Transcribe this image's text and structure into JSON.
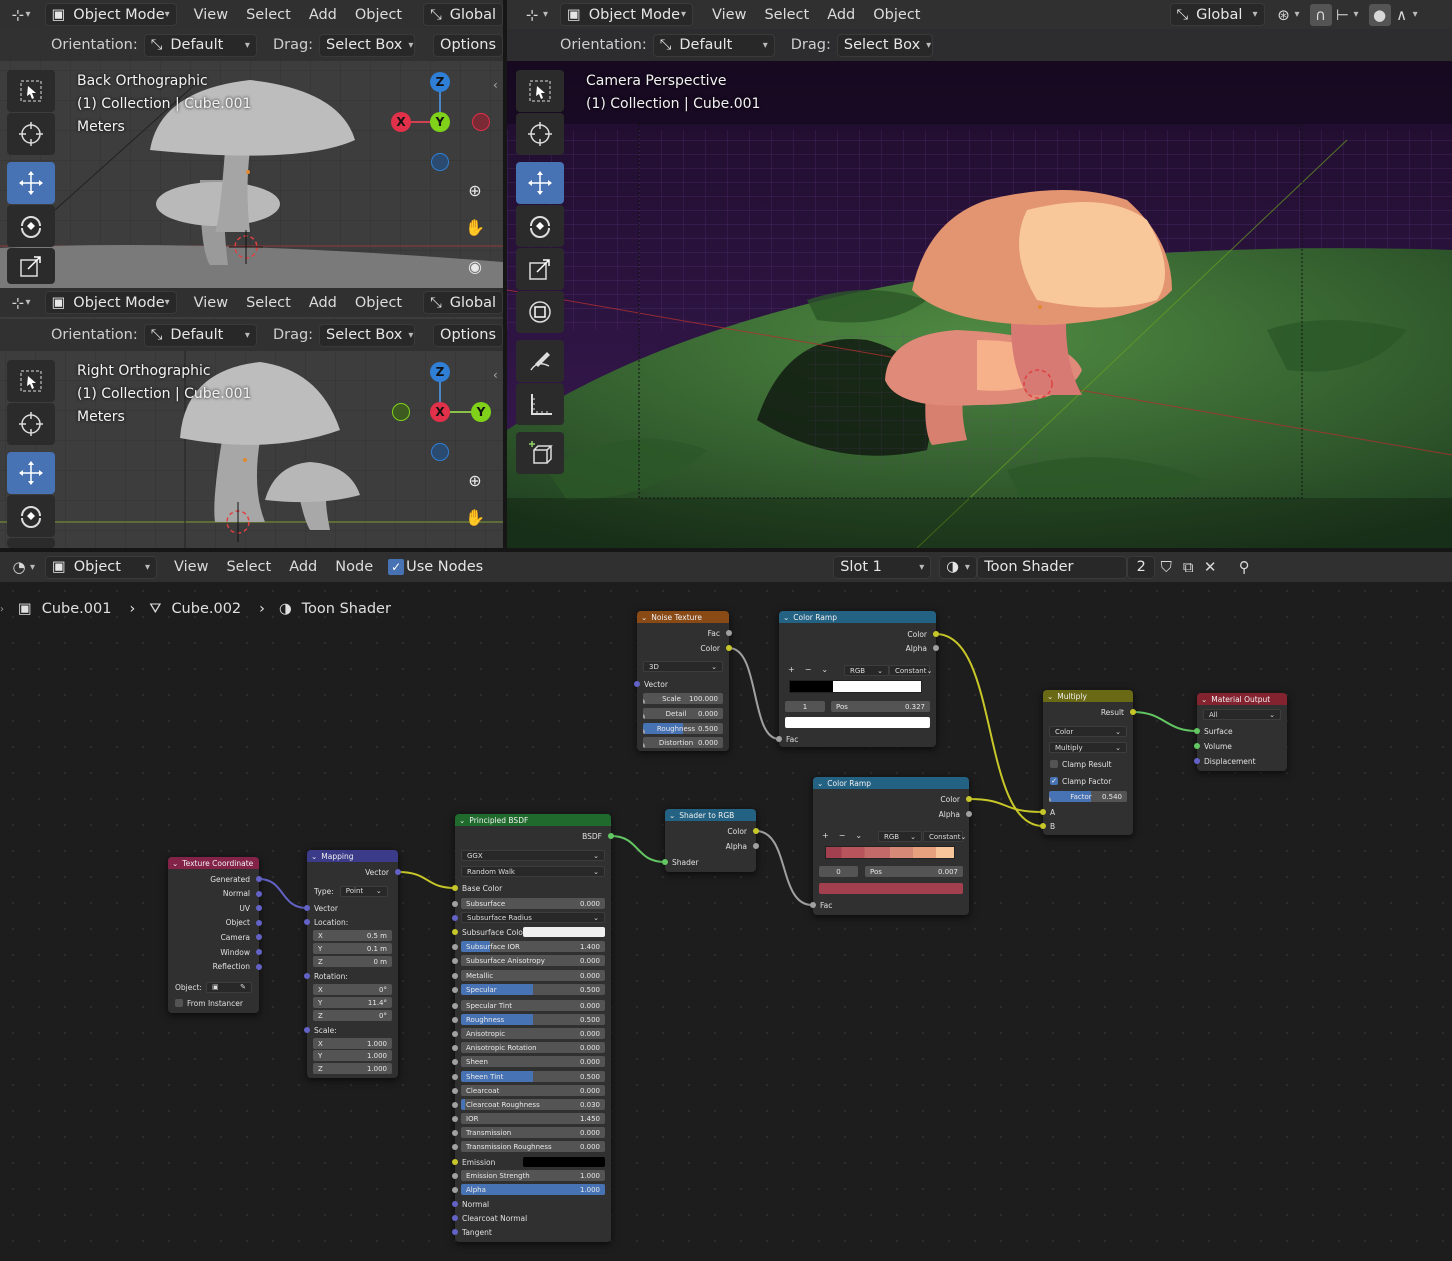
{
  "menus": {
    "object_mode": "Object Mode",
    "view": "View",
    "select": "Select",
    "add": "Add",
    "object": "Object",
    "node": "Node",
    "global": "Global"
  },
  "tool_settings": {
    "orientation_label": "Orientation:",
    "orientation_value": "Default",
    "drag_label": "Drag:",
    "drag_value": "Select Box",
    "options": "Options"
  },
  "viewports": {
    "back": {
      "line1": "Back Orthographic",
      "line2": "(1) Collection | Cube.001",
      "line3": "Meters"
    },
    "right": {
      "line1": "Right Orthographic",
      "line2": "(1) Collection | Cube.001",
      "line3": "Meters"
    },
    "camera": {
      "line1": "Camera Perspective",
      "line2": "(1) Collection | Cube.001"
    }
  },
  "gizmo": {
    "x": "X",
    "y": "Y",
    "z": "Z"
  },
  "node_editor": {
    "header": {
      "object": "Object",
      "use_nodes": "Use Nodes",
      "slot": "Slot 1",
      "material": "Toon Shader",
      "users": "2"
    },
    "breadcrumb": [
      "Cube.001",
      "Cube.002",
      "Toon Shader"
    ],
    "nodes": {
      "noise": {
        "title": "Noise Texture",
        "fac": "Fac",
        "color": "Color",
        "dim": "3D",
        "vector": "Vector",
        "scale_l": "Scale",
        "scale_v": "100.000",
        "detail_l": "Detail",
        "detail_v": "0.000",
        "rough_l": "Roughness",
        "rough_v": "0.500",
        "dist_l": "Distortion",
        "dist_v": "0.000"
      },
      "ramp1": {
        "title": "Color Ramp",
        "color": "Color",
        "alpha": "Alpha",
        "mode": "RGB",
        "interp": "Constant",
        "plus": "+",
        "minus": "−",
        "idx": "1",
        "pos_l": "Pos",
        "pos_v": "0.327",
        "fac": "Fac"
      },
      "ramp2": {
        "title": "Color Ramp",
        "color": "Color",
        "alpha": "Alpha",
        "mode": "RGB",
        "interp": "Constant",
        "plus": "+",
        "minus": "−",
        "idx": "0",
        "pos_l": "Pos",
        "pos_v": "0.007",
        "fac": "Fac"
      },
      "multiply": {
        "title": "Multiply",
        "result": "Result",
        "type": "Color",
        "op": "Multiply",
        "clamp_result": "Clamp Result",
        "clamp_factor": "Clamp Factor",
        "factor_l": "Factor",
        "factor_v": "0.540",
        "a": "A",
        "b": "B"
      },
      "output": {
        "title": "Material Output",
        "target": "All",
        "surface": "Surface",
        "volume": "Volume",
        "displacement": "Displacement"
      },
      "shader_rgb": {
        "title": "Shader to RGB",
        "color": "Color",
        "alpha": "Alpha",
        "shader": "Shader"
      },
      "texcoord": {
        "title": "Texture Coordinate",
        "outputs": [
          "Generated",
          "Normal",
          "UV",
          "Object",
          "Camera",
          "Window",
          "Reflection"
        ],
        "object_l": "Object:",
        "from_instancer": "From Instancer"
      },
      "mapping": {
        "title": "Mapping",
        "vector_out": "Vector",
        "type_l": "Type:",
        "type_v": "Point",
        "vector_in": "Vector",
        "location": "Location:",
        "loc": [
          "0.5 m",
          "0.1 m",
          "0 m"
        ],
        "rotation": "Rotation:",
        "rot": [
          "0°",
          "11.4°",
          "0°"
        ],
        "scale": "Scale:",
        "scl": [
          "1.000",
          "1.000",
          "1.000"
        ],
        "x": "X",
        "y": "Y",
        "z": "Z"
      },
      "bsdf": {
        "title": "Principled BSDF",
        "out": "BSDF",
        "distribution": "GGX",
        "sss_method": "Random Walk",
        "base_color": "Base Color",
        "rows": [
          [
            "Subsurface",
            "0.000",
            0
          ],
          [
            "Subsurface Radius",
            "",
            -1
          ],
          [
            "Subsurface Color",
            "",
            -2
          ],
          [
            "Subsurface IOR",
            "1.400",
            0.2
          ],
          [
            "Subsurface Anisotropy",
            "0.000",
            0
          ],
          [
            "Metallic",
            "0.000",
            0
          ],
          [
            "Specular",
            "0.500",
            0.5
          ],
          [
            "Specular Tint",
            "0.000",
            0
          ],
          [
            "Roughness",
            "0.500",
            0.5
          ],
          [
            "Anisotropic",
            "0.000",
            0
          ],
          [
            "Anisotropic Rotation",
            "0.000",
            0
          ],
          [
            "Sheen",
            "0.000",
            0
          ],
          [
            "Sheen Tint",
            "0.500",
            0.5
          ],
          [
            "Clearcoat",
            "0.000",
            0
          ],
          [
            "Clearcoat Roughness",
            "0.030",
            0.03
          ],
          [
            "IOR",
            "1.450",
            0
          ],
          [
            "Transmission",
            "0.000",
            0
          ],
          [
            "Transmission Roughness",
            "0.000",
            0
          ],
          [
            "Emission",
            "",
            -3
          ],
          [
            "Emission Strength",
            "1.000",
            0
          ],
          [
            "Alpha",
            "1.000",
            1
          ]
        ],
        "normal": "Normal",
        "clearcoat_normal": "Clearcoat Normal",
        "tangent": "Tangent"
      }
    }
  }
}
